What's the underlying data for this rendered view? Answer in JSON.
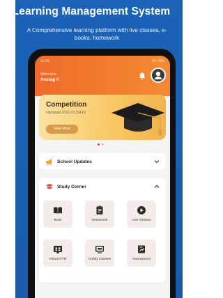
{
  "banner": {
    "headline": "Learning Management System",
    "subline": "A Comprehensive learning platform with live classes, e-books, homework"
  },
  "status": {
    "time": "16:43",
    "icons": "4G 72%"
  },
  "header": {
    "welcome": "Welcome",
    "username": "Anurag K"
  },
  "competition_card": {
    "title": "Competition",
    "subtitle": "Olympiad 2022-23 (SIFO)",
    "button": "View More"
  },
  "school_updates": {
    "title": "School Updates"
  },
  "study_corner": {
    "title": "Study Corner",
    "items": [
      {
        "label": "Book",
        "icon": "book-icon"
      },
      {
        "label": "Homework",
        "icon": "homework-icon"
      },
      {
        "label": "Live Classes",
        "icon": "live-classes-icon"
      },
      {
        "label": "Virtual PTM",
        "icon": "virtual-ptm-icon"
      },
      {
        "label": "Hobby Classes",
        "icon": "hobby-classes-icon"
      },
      {
        "label": "Assessment",
        "icon": "assessment-icon"
      }
    ]
  },
  "colors": {
    "banner_blue": "#1a63b8",
    "header_orange": "#ef6b2a",
    "card_yellow": "#f8c762",
    "tile_bg": "#f3ecea"
  }
}
